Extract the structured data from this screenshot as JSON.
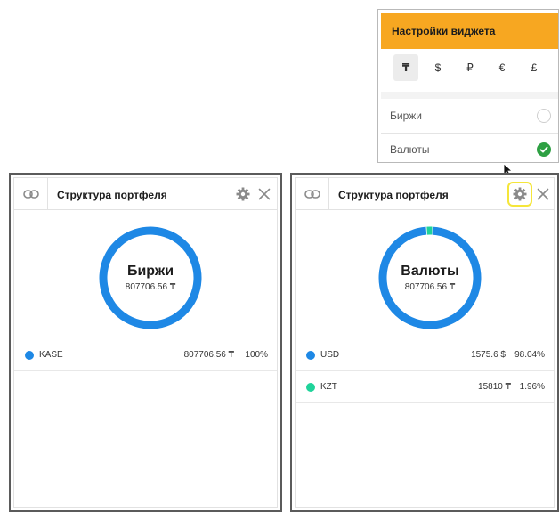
{
  "settings": {
    "title": "Настройки виджета",
    "currencies": [
      "₸",
      "$",
      "₽",
      "€",
      "£"
    ],
    "active_currency": "₸",
    "options": [
      {
        "label": "Биржи",
        "selected": false
      },
      {
        "label": "Валюты",
        "selected": true
      }
    ]
  },
  "widgets": [
    {
      "title": "Структура портфеля",
      "center_label": "Биржи",
      "center_value": "807706.56 ₸",
      "rows": [
        {
          "name": "KASE",
          "value": "807706.56 ₸",
          "percent": "100%",
          "color": "#1e88e5"
        }
      ],
      "segments": [
        {
          "fraction": 1.0,
          "color": "#1e88e5"
        }
      ]
    },
    {
      "title": "Структура портфеля",
      "center_label": "Валюты",
      "center_value": "807706.56 ₸",
      "rows": [
        {
          "name": "USD",
          "value": "1575.6 $",
          "percent": "98.04%",
          "color": "#1e88e5"
        },
        {
          "name": "KZT",
          "value": "15810 ₸",
          "percent": "1.96%",
          "color": "#1fd39a"
        }
      ],
      "segments": [
        {
          "fraction": 0.9804,
          "color": "#1e88e5"
        },
        {
          "fraction": 0.0196,
          "color": "#1fd39a"
        }
      ]
    }
  ],
  "icons": {
    "link": "link-icon",
    "gear": "gear-icon",
    "close": "close-icon",
    "check": "check-icon",
    "cursor": "cursor-icon"
  }
}
